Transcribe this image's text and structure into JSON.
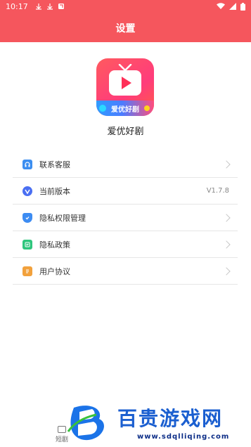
{
  "status_bar": {
    "time": "10:17"
  },
  "header": {
    "title": "设置"
  },
  "app": {
    "logo_badge_text": "爱优好剧",
    "name": "爱优好剧"
  },
  "settings": {
    "items": [
      {
        "label": "联系客服",
        "icon": "customer-service-icon",
        "icon_color": "#3c8ef0",
        "value": ""
      },
      {
        "label": "当前版本",
        "icon": "version-icon",
        "icon_color": "#4a6ff2",
        "value": "V1.7.8"
      },
      {
        "label": "隐私权限管理",
        "icon": "shield-icon",
        "icon_color": "#3d8cf2",
        "value": ""
      },
      {
        "label": "隐私政策",
        "icon": "document-icon",
        "icon_color": "#2fc67d",
        "value": ""
      },
      {
        "label": "用户协议",
        "icon": "agreement-icon",
        "icon_color": "#f2a13c",
        "value": ""
      }
    ]
  },
  "bottom_tab": {
    "label": "短剧"
  },
  "watermark": {
    "title": "百贵游戏网",
    "url": "www.sdqlliqing.com"
  },
  "colors": {
    "accent": "#f5565d",
    "watermark_blue": "#1b5fd0"
  }
}
